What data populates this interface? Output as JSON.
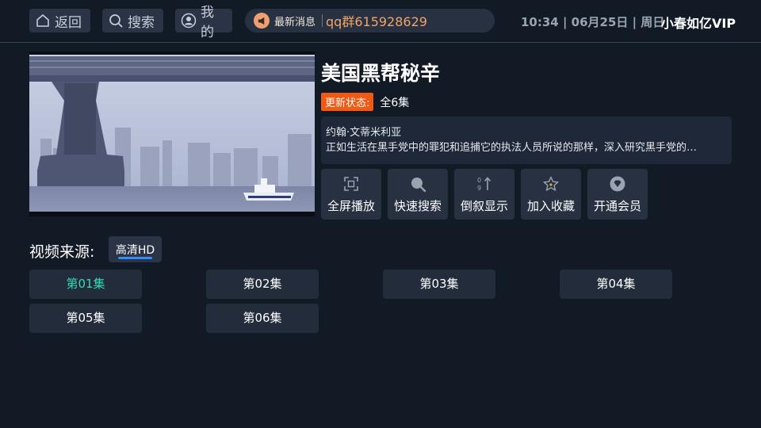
{
  "nav": {
    "back_label": "返回",
    "search_label": "搜索",
    "mine_label": "我的"
  },
  "ticker": {
    "badge": "最新消息",
    "text": "qq群615928629"
  },
  "status": {
    "clock_line": "10:34 | 06月25日 | 周日",
    "brand": "小春如亿VIP"
  },
  "detail": {
    "title": "美国黑帮秘辛",
    "update_label": "更新状态:",
    "update_value": "全6集",
    "cast": "约翰·文蒂米利亚",
    "synopsis": "正如生活在黑手党中的罪犯和追捕它的执法人员所说的那样，深入研究黑手党的…"
  },
  "actions": [
    {
      "label": "全屏播放",
      "icon": "fullscreen-icon"
    },
    {
      "label": "快速搜索",
      "icon": "search-icon"
    },
    {
      "label": "倒叙显示",
      "icon": "sort-icon"
    },
    {
      "label": "加入收藏",
      "icon": "star-icon"
    },
    {
      "label": "开通会员",
      "icon": "vip-diamond-icon"
    }
  ],
  "source": {
    "label": "视频来源:",
    "selected": "高清HD"
  },
  "episodes": [
    "第01集",
    "第02集",
    "第03集",
    "第04集",
    "第05集",
    "第06集"
  ],
  "colors": {
    "background": "#121a26",
    "accent_orange": "#f05a14",
    "ticker_text": "#f2a468",
    "active_episode": "#33d9b2",
    "source_underline": "#2f8fff"
  }
}
